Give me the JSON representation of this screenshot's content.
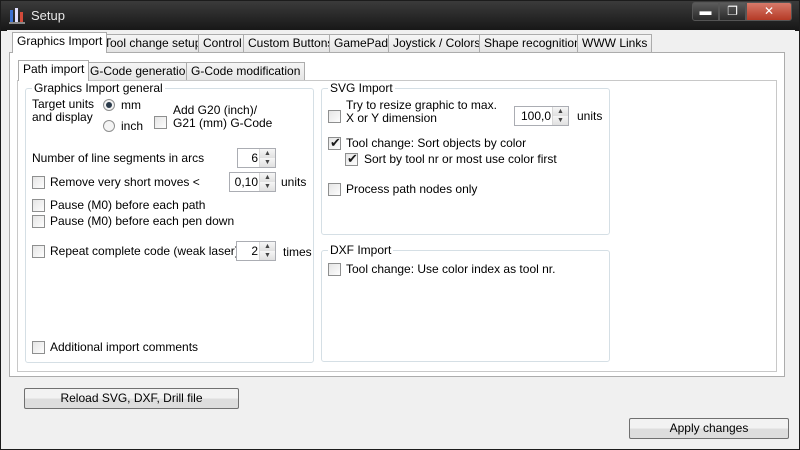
{
  "window": {
    "title": "Setup",
    "min_glyph": "▬",
    "max_glyph": "❐",
    "close_glyph": "✕",
    "icon": "setup-app-icon"
  },
  "main_tabs": [
    {
      "label": "Graphics Import"
    },
    {
      "label": "Tool change setup"
    },
    {
      "label": "Control"
    },
    {
      "label": "Custom Buttons"
    },
    {
      "label": "GamePad"
    },
    {
      "label": "Joystick / Colors"
    },
    {
      "label": "Shape recognition"
    },
    {
      "label": "WWW Links"
    }
  ],
  "sub_tabs": [
    {
      "label": "Path import"
    },
    {
      "label": "G-Code generation"
    },
    {
      "label": "G-Code modification"
    }
  ],
  "general": {
    "title": "Graphics Import general",
    "target_units_label": "Target units\nand display",
    "unit_mm": "mm",
    "unit_inch": "inch",
    "selected_unit": "mm",
    "add_g20_label": "Add G20 (inch)/\nG21 (mm) G-Code",
    "add_g20_checked": false,
    "line_segments_label": "Number of line segments in arcs",
    "line_segments_value": "6",
    "remove_short_label": "Remove very short moves <",
    "remove_short_checked": false,
    "remove_short_value": "0,10",
    "remove_short_unit": "units",
    "pause_path_label": "Pause (M0) before each path",
    "pause_path_checked": false,
    "pause_pen_label": "Pause (M0) before each pen down",
    "pause_pen_checked": false,
    "repeat_label": "Repeat complete code (weak laser)",
    "repeat_checked": false,
    "repeat_value": "2",
    "repeat_unit": "times",
    "additional_label": "Additional import comments",
    "additional_checked": false
  },
  "svg": {
    "title": "SVG Import",
    "resize_label": "Try to resize graphic to max.\nX or Y dimension",
    "resize_checked": false,
    "resize_value": "100,0",
    "resize_unit": "units",
    "tool_change_label": "Tool change: Sort objects by color",
    "tool_change_checked": true,
    "sort_label": "Sort by tool nr or most use color first",
    "sort_checked": true,
    "nodes_label": "Process path nodes only",
    "nodes_checked": false
  },
  "dxf": {
    "title": "DXF Import",
    "color_index_label": "Tool change: Use color index as tool nr.",
    "color_index_checked": false
  },
  "buttons": {
    "reload": "Reload SVG, DXF, Drill file",
    "apply": "Apply changes"
  },
  "glyphs": {
    "check": "✔",
    "up": "▲",
    "down": "▼"
  }
}
